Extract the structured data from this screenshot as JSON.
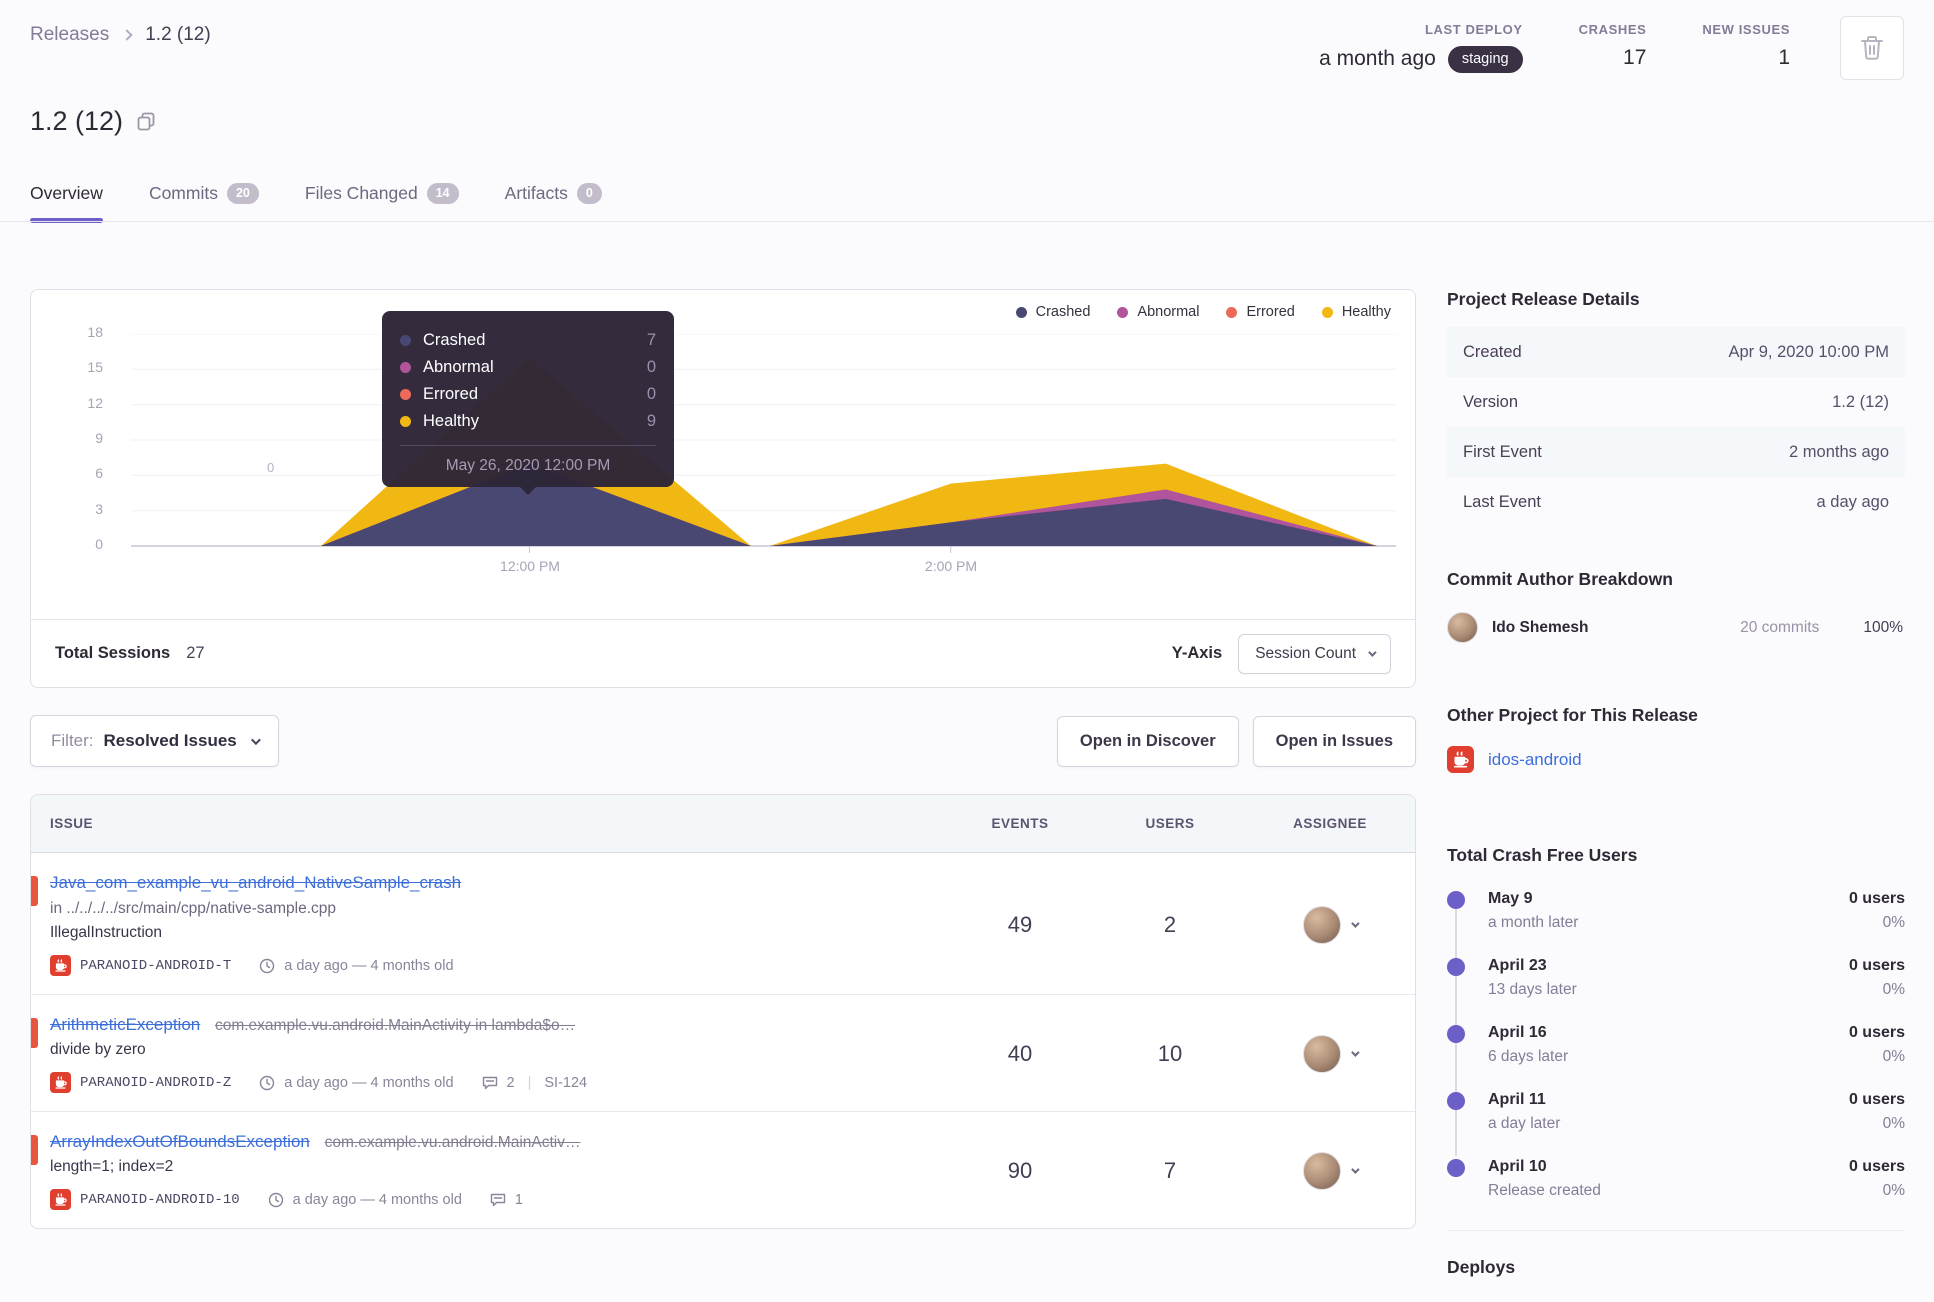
{
  "breadcrumb": {
    "parent": "Releases",
    "current": "1.2 (12)"
  },
  "header": {
    "title": "1.2 (12)",
    "stats": {
      "deploy_label": "LAST DEPLOY",
      "deploy_value": "a month ago",
      "deploy_badge": "staging",
      "crashes_label": "CRASHES",
      "crashes_value": "17",
      "new_issues_label": "NEW ISSUES",
      "new_issues_value": "1"
    }
  },
  "tabs": {
    "overview": "Overview",
    "commits": "Commits",
    "commits_count": "20",
    "files": "Files Changed",
    "files_count": "14",
    "artifacts": "Artifacts",
    "artifacts_count": "0"
  },
  "chart": {
    "legend": [
      "Crashed",
      "Abnormal",
      "Errored",
      "Healthy"
    ],
    "tooltip": {
      "rows": [
        {
          "series": "crashed",
          "label": "Crashed",
          "value": "7"
        },
        {
          "series": "abnormal",
          "label": "Abnormal",
          "value": "0"
        },
        {
          "series": "errored",
          "label": "Errored",
          "value": "0"
        },
        {
          "series": "healthy",
          "label": "Healthy",
          "value": "9"
        }
      ],
      "footer": "May 26, 2020 12:00 PM"
    },
    "y_ticks": [
      "18",
      "15",
      "12",
      "9",
      "6",
      "3",
      "0"
    ],
    "x_ticks": [
      "12:00 PM",
      "2:00 PM"
    ],
    "ghost_label": "0",
    "footer": {
      "total_label": "Total Sessions",
      "total_value": "27",
      "yaxis_label": "Y-Axis",
      "yaxis_value": "Session Count"
    }
  },
  "chart_data": {
    "type": "area",
    "stacked": true,
    "title": "Release sessions over time",
    "ylabel": "Session Count",
    "ylim": [
      0,
      18
    ],
    "y_tick_values": [
      0,
      3,
      6,
      9,
      12,
      15,
      18
    ],
    "x_tick_positions": [
      {
        "label": "12:00 PM",
        "x": 0.315
      },
      {
        "label": "2:00 PM",
        "x": 0.648
      }
    ],
    "series_order": [
      "crashed",
      "abnormal",
      "errored",
      "healthy"
    ],
    "colors": {
      "crashed": "#484873",
      "abnormal": "#b0549b",
      "errored": "#ec6a57",
      "healthy": "#f1b712"
    },
    "points": [
      {
        "x": 0.0,
        "crashed": 0,
        "abnormal": 0,
        "errored": 0,
        "healthy": 0
      },
      {
        "x": 0.15,
        "crashed": 0,
        "abnormal": 0,
        "errored": 0,
        "healthy": 0
      },
      {
        "x": 0.315,
        "crashed": 7,
        "abnormal": 0,
        "errored": 0,
        "healthy": 9
      },
      {
        "x": 0.49,
        "crashed": 0,
        "abnormal": 0,
        "errored": 0,
        "healthy": 0
      },
      {
        "x": 0.505,
        "crashed": 0,
        "abnormal": 0,
        "errored": 0,
        "healthy": 0
      },
      {
        "x": 0.648,
        "crashed": 2,
        "abnormal": 0,
        "errored": 0,
        "healthy": 3.3
      },
      {
        "x": 0.818,
        "crashed": 4,
        "abnormal": 0.8,
        "errored": 0,
        "healthy": 2.2
      },
      {
        "x": 0.985,
        "crashed": 0,
        "abnormal": 0,
        "errored": 0,
        "healthy": 0
      },
      {
        "x": 1.0,
        "crashed": 0,
        "abnormal": 0,
        "errored": 0,
        "healthy": 0
      }
    ],
    "hover": {
      "x": 0.315,
      "label": "May 26, 2020 12:00 PM",
      "values": {
        "crashed": 7,
        "abnormal": 0,
        "errored": 0,
        "healthy": 9
      }
    },
    "total_sessions": 27,
    "legend_position": "top-right",
    "grid": true
  },
  "toolbar": {
    "filter_label": "Filter:",
    "filter_value": "Resolved Issues",
    "discover_button": "Open in Discover",
    "issues_button": "Open in Issues"
  },
  "issues_table": {
    "columns": {
      "issue": "ISSUE",
      "events": "EVENTS",
      "users": "USERS",
      "assignee": "ASSIGNEE"
    },
    "rows": [
      {
        "title": "Java_com_example_vu_android_NativeSample_crash",
        "location": "in ../../../../src/main/cpp/native-sample.cpp",
        "message": "IllegalInstruction",
        "project": "PARANOID-ANDROID-T",
        "age": "a day ago — 4 months old",
        "events": "49",
        "users": "2"
      },
      {
        "title": "ArithmeticException",
        "suffix": "com.example.vu.android.MainActivity in lambda$o…",
        "message": "divide by zero",
        "project": "PARANOID-ANDROID-Z",
        "age": "a day ago — 4 months old",
        "comments": "2",
        "short_id": "SI-124",
        "events": "40",
        "users": "10"
      },
      {
        "title": "ArrayIndexOutOfBoundsException",
        "suffix": "com.example.vu.android.MainActiv…",
        "message": "length=1; index=2",
        "project": "PARANOID-ANDROID-10",
        "age": "a day ago — 4 months old",
        "comments": "1",
        "events": "90",
        "users": "7"
      }
    ]
  },
  "sidebar": {
    "release_details": {
      "title": "Project Release Details",
      "rows": [
        {
          "label": "Created",
          "value": "Apr 9, 2020 10:00 PM"
        },
        {
          "label": "Version",
          "value": "1.2 (12)"
        },
        {
          "label": "First Event",
          "value": "2 months ago"
        },
        {
          "label": "Last Event",
          "value": "a day ago"
        }
      ]
    },
    "commit_authors": {
      "title": "Commit Author Breakdown",
      "author": "Ido Shemesh",
      "commits": "20 commits",
      "percent": "100%"
    },
    "other_project": {
      "title": "Other Project for This Release",
      "link": "idos-android"
    },
    "crash_free": {
      "title": "Total Crash Free Users",
      "items": [
        {
          "date": "May 9",
          "sub": "a month later",
          "users": "0 users",
          "pct": "0%"
        },
        {
          "date": "April 23",
          "sub": "13 days later",
          "users": "0 users",
          "pct": "0%"
        },
        {
          "date": "April 16",
          "sub": "6 days later",
          "users": "0 users",
          "pct": "0%"
        },
        {
          "date": "April 11",
          "sub": "a day later",
          "users": "0 users",
          "pct": "0%"
        },
        {
          "date": "April 10",
          "sub": "Release created",
          "users": "0 users",
          "pct": "0%"
        }
      ]
    },
    "deploys_title": "Deploys"
  }
}
